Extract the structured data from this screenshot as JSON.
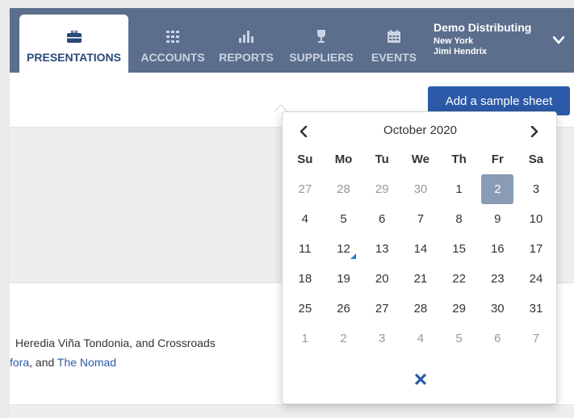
{
  "nav": {
    "tabs": [
      {
        "label": "PRESENTATIONS",
        "icon": "briefcase-icon",
        "active": true
      },
      {
        "label": "ACCOUNTS",
        "icon": "grid-icon",
        "active": false
      },
      {
        "label": "REPORTS",
        "icon": "bar-chart-icon",
        "active": false
      },
      {
        "label": "SUPPLIERS",
        "icon": "wine-glass-icon",
        "active": false
      },
      {
        "label": "EVENTS",
        "icon": "calendar-icon",
        "active": false
      }
    ],
    "account": {
      "company": "Demo Distributing",
      "location": "New York",
      "user": "Jimi Hendrix"
    }
  },
  "toolbar": {
    "add_sample_label": "Add a sample sheet"
  },
  "card": {
    "line1": "Heredia Viña Tondonia, and Crossroads",
    "line2_link1": "fora",
    "line2_mid": ", and ",
    "line2_link2": "The Nomad"
  },
  "calendar": {
    "month_label": "October 2020",
    "weekdays": [
      "Su",
      "Mo",
      "Tu",
      "We",
      "Th",
      "Fr",
      "Sa"
    ],
    "weeks": [
      [
        "27",
        "28",
        "29",
        "30",
        "1",
        "2",
        "3"
      ],
      [
        "4",
        "5",
        "6",
        "7",
        "8",
        "9",
        "10"
      ],
      [
        "11",
        "12",
        "13",
        "14",
        "15",
        "16",
        "17"
      ],
      [
        "18",
        "19",
        "20",
        "21",
        "22",
        "23",
        "24"
      ],
      [
        "25",
        "26",
        "27",
        "28",
        "29",
        "30",
        "31"
      ],
      [
        "1",
        "2",
        "3",
        "4",
        "5",
        "6",
        "7"
      ]
    ],
    "selected_day": "2",
    "marked_day": "12",
    "colors": {
      "selected_bg": "#8a9bb6",
      "accent": "#2c5aa8",
      "marker": "#2c7bd6"
    }
  }
}
